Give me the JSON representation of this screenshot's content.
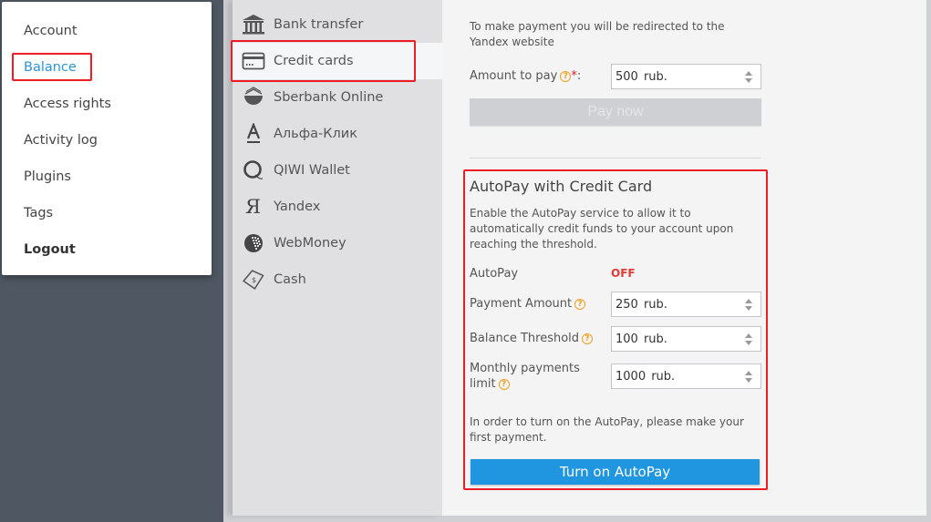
{
  "user_menu": {
    "items": [
      {
        "label": "Account"
      },
      {
        "label": "Balance",
        "active": true
      },
      {
        "label": "Access rights"
      },
      {
        "label": "Activity log"
      },
      {
        "label": "Plugins"
      },
      {
        "label": "Tags"
      },
      {
        "label": "Logout",
        "bold": true
      }
    ]
  },
  "payment_methods": {
    "items": [
      {
        "label": "Bank transfer",
        "icon": "bank-icon"
      },
      {
        "label": "Credit cards",
        "icon": "credit-card-icon",
        "active": true
      },
      {
        "label": "Sberbank Online",
        "icon": "sberbank-icon"
      },
      {
        "label": "Альфа-Клик",
        "icon": "alfa-bank-icon"
      },
      {
        "label": "QIWI Wallet",
        "icon": "qiwi-icon"
      },
      {
        "label": "Yandex",
        "icon": "yandex-icon"
      },
      {
        "label": "WebMoney",
        "icon": "webmoney-icon"
      },
      {
        "label": "Cash",
        "icon": "cash-icon"
      }
    ]
  },
  "payment": {
    "redirect_note": "To make payment you will be redirected to the Yandex website",
    "amount_label": "Amount to pay",
    "amount_required_mark": "*",
    "amount_suffix": ":",
    "amount_value": "500  rub.",
    "pay_now_label": "Pay now"
  },
  "autopay": {
    "title": "AutoPay with Credit Card",
    "description": "Enable the AutoPay service to allow it to automatically credit funds to your account upon reaching the threshold.",
    "status_label": "AutoPay",
    "status_value": "OFF",
    "payment_amount_label": "Payment Amount",
    "payment_amount_value": "250  rub.",
    "balance_threshold_label": "Balance Threshold",
    "balance_threshold_value": "100  rub.",
    "monthly_limit_label_1": "Monthly payments",
    "monthly_limit_label_2": "limit",
    "monthly_limit_value": "1000  rub.",
    "first_payment_note": "In order to turn on the AutoPay, please make your first payment.",
    "turn_on_label": "Turn on AutoPay"
  },
  "colors": {
    "accent": "#2196e0",
    "active_link": "#2a95d6",
    "highlight": "#ee1c24",
    "status_off": "#e53935",
    "help": "#f0a020"
  }
}
